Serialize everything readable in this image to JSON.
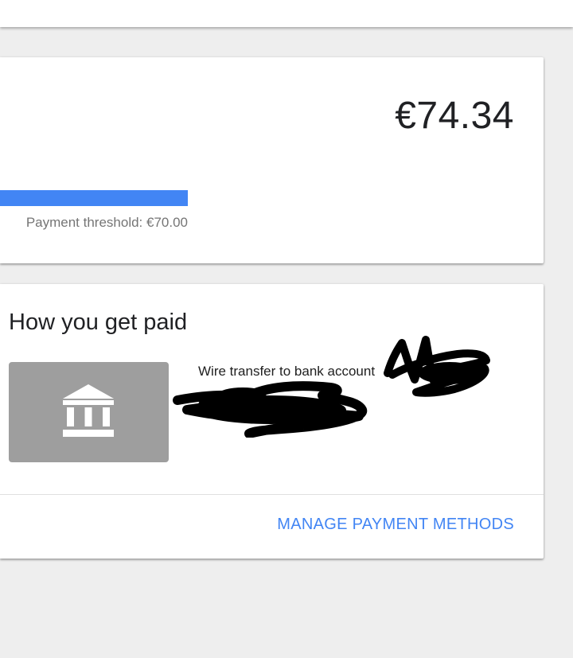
{
  "balance": {
    "amount": "€74.34",
    "threshold_text": "Payment threshold: €70.00",
    "progress_fraction": 1.0,
    "accent_color": "#4285f4"
  },
  "payment": {
    "title": "How you get paid",
    "method_label": "Wire transfer to bank account",
    "method_icon": "bank-icon",
    "manage_label": "MANAGE PAYMENT METHODS"
  }
}
